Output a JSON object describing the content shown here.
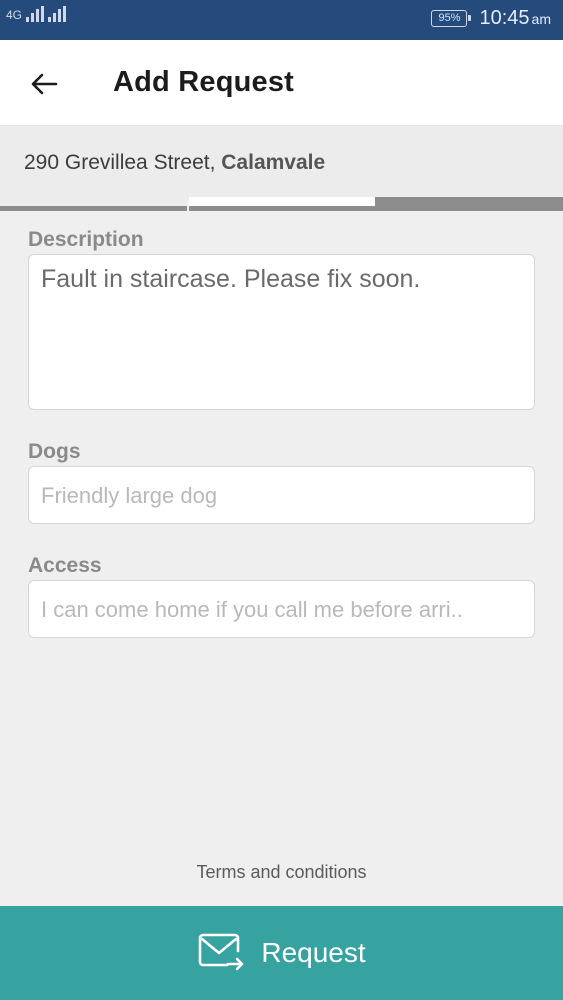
{
  "status_bar": {
    "network": "4G",
    "battery": "95%",
    "time": "10:45",
    "ampm": "am"
  },
  "header": {
    "title": "Add Request"
  },
  "address": {
    "street": "290 Grevillea Street, ",
    "suburb": "Calamvale"
  },
  "progress": {
    "steps": 3,
    "current_step": 3
  },
  "form": {
    "description": {
      "label": "Description",
      "value": "Fault in staircase. Please fix soon."
    },
    "dogs": {
      "label": "Dogs",
      "placeholder": "Friendly large dog"
    },
    "access": {
      "label": "Access",
      "placeholder": "I can come home if you call me before arri.."
    }
  },
  "footer": {
    "terms_label": "Terms and conditions",
    "request_label": "Request"
  },
  "colors": {
    "status_bar": "#254a7c",
    "accent": "#37a3a0",
    "background": "#efeff0"
  },
  "icons": {
    "back": "arrow-left-icon",
    "request": "envelope-arrow-icon"
  }
}
